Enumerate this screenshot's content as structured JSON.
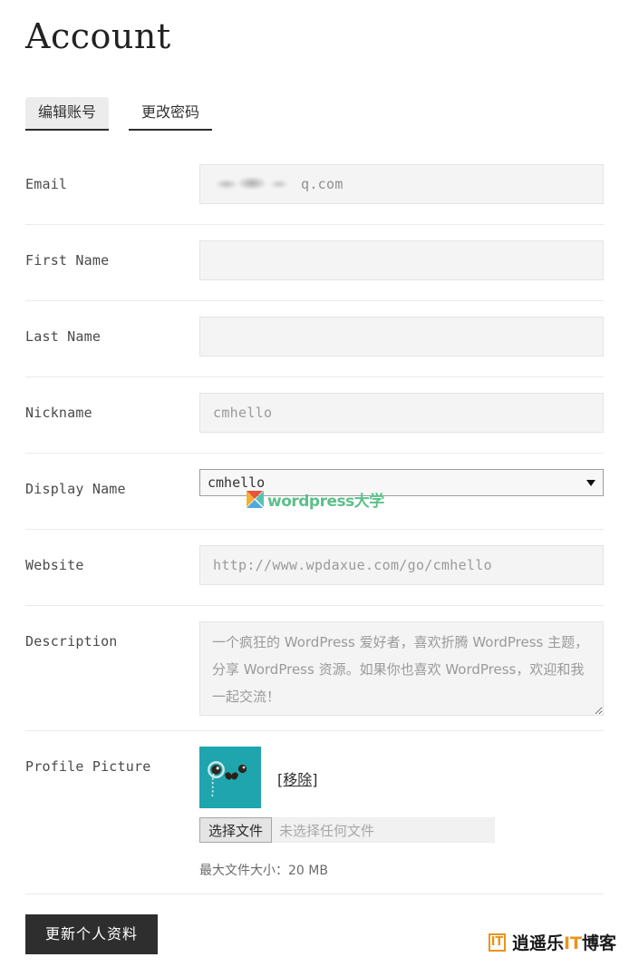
{
  "page": {
    "title": "Account",
    "accent_dark": "#2e2e2e",
    "field_bg": "#f4f4f4",
    "separator": "#ebebeb"
  },
  "tabs": [
    {
      "label": "编辑账号",
      "active": true
    },
    {
      "label": "更改密码",
      "active": false
    }
  ],
  "fields": {
    "email": {
      "label": "Email",
      "redacted": true,
      "visible_value": "q.com"
    },
    "first_name": {
      "label": "First Name",
      "value": "",
      "placeholder": ""
    },
    "last_name": {
      "label": "Last Name",
      "value": "",
      "placeholder": ""
    },
    "nickname": {
      "label": "Nickname",
      "value": "cmhello",
      "placeholder": "cmhello"
    },
    "display_name": {
      "label": "Display Name",
      "selected": "cmhello",
      "options": [
        "cmhello"
      ]
    },
    "website": {
      "label": "Website",
      "value": "http://www.wpdaxue.com/go/cmhello",
      "placeholder": "http://www.wpdaxue.com/go/cmhello"
    },
    "description": {
      "label": "Description",
      "value": "一个疯狂的 WordPress 爱好者，喜欢折腾 WordPress 主题，分享 WordPress 资源。如果你也喜欢 WordPress，欢迎和我一起交流！"
    },
    "profile_picture": {
      "label": "Profile Picture",
      "avatar_bg": "#1fa5ad",
      "remove_label": "[移除]",
      "file_button_label": "选择文件",
      "file_status": "未选择任何文件",
      "max_size_note": "最大文件大小：20 MB"
    }
  },
  "submit": {
    "label": "更新个人资料"
  },
  "watermarks": {
    "wpdaxue": {
      "text": "wordpress大学",
      "color": "#5cc08a"
    },
    "xiaoyaole": {
      "mark": "IT",
      "part1": "逍遥乐",
      "part2": "IT",
      "part3": "博客",
      "accent": "#e8951c"
    }
  }
}
